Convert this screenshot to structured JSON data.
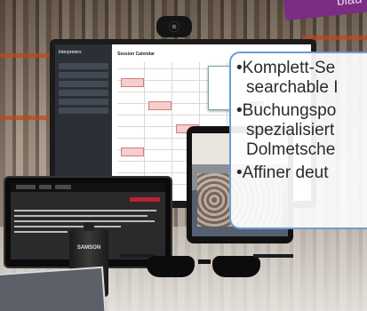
{
  "tag": {
    "text": "blau"
  },
  "laptop_app": {
    "sidebar_title": "Interpreters",
    "calendar_title": "Session Calendar"
  },
  "receiver": {
    "brand": "SAMSON"
  },
  "callout": {
    "bullets": [
      {
        "line1": "•Komplett-Se",
        "line2": "searchable I"
      },
      {
        "line1": "•Buchungspo",
        "line2": "spezialisiert",
        "line3": "Dolmetsche"
      },
      {
        "line1": "•Affiner deut"
      }
    ]
  },
  "colors": {
    "tag_purple": "#7b2d83",
    "callout_border": "#6c9bd2",
    "popup_button": "#c0392b"
  }
}
